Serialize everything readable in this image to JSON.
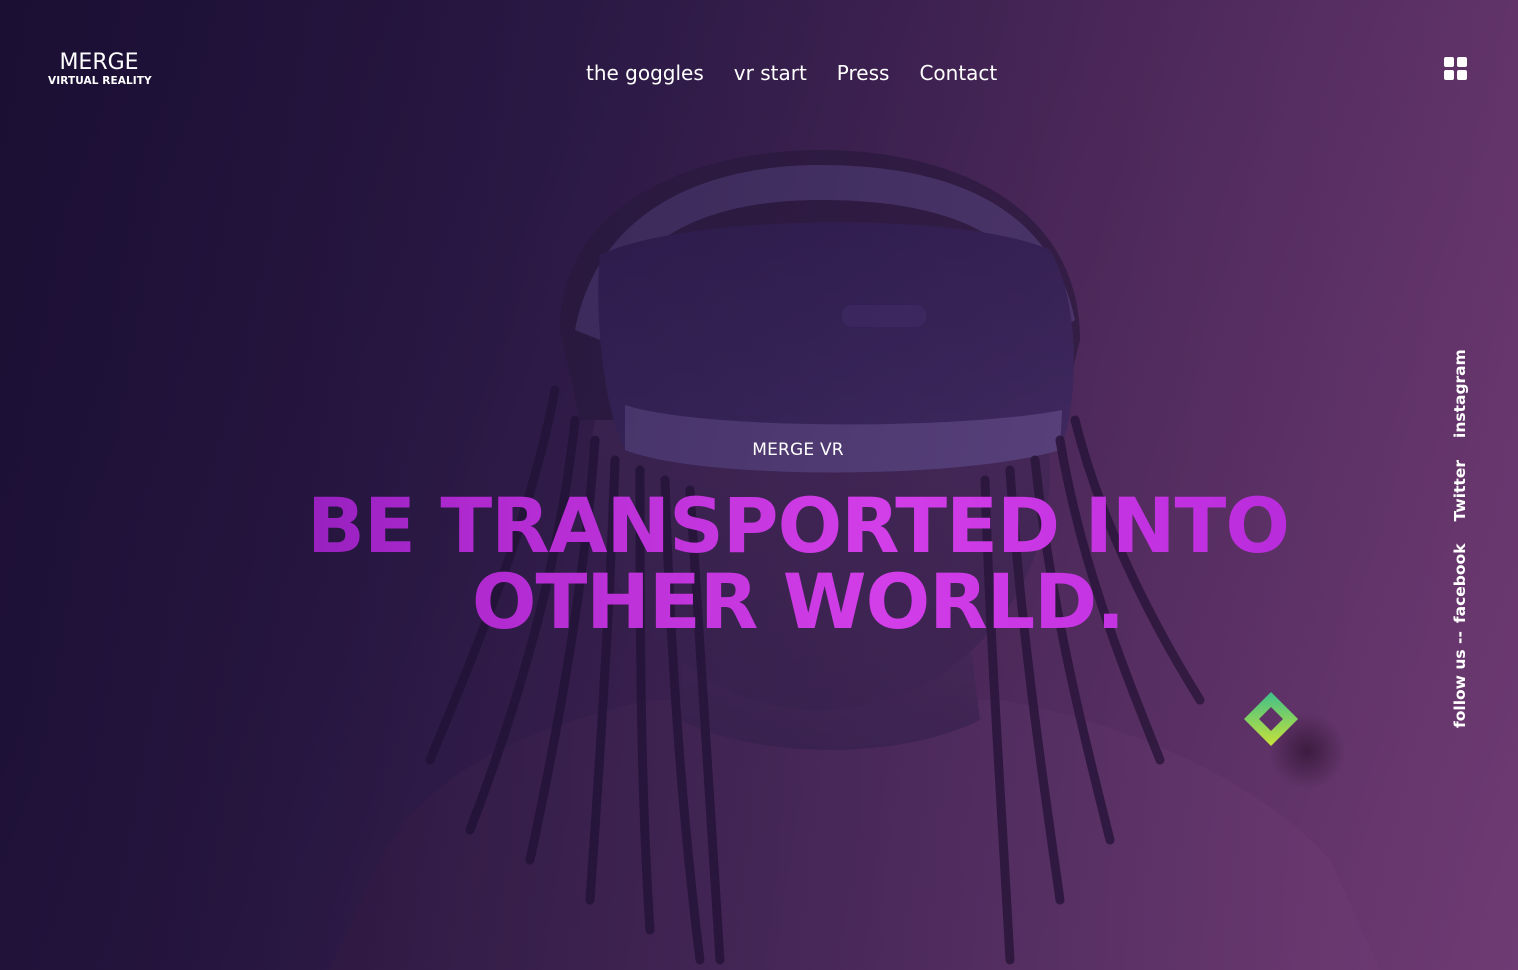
{
  "brand": {
    "name": "MERGE",
    "tagline": "VIRTUAL REALITY"
  },
  "nav": {
    "items": [
      {
        "label": "the goggles"
      },
      {
        "label": "vr start"
      },
      {
        "label": "Press"
      },
      {
        "label": "Contact"
      }
    ],
    "menu_icon": "grid-icon"
  },
  "hero": {
    "kicker": "MERGE VR",
    "headline_line1": "BE TRANSPORTED INTO",
    "headline_line2": "OTHER WORLD.",
    "background": "person-wearing-vr-headset"
  },
  "social": {
    "prefix": "follow us --",
    "links": [
      {
        "label": "facebook"
      },
      {
        "label": "Twitter"
      },
      {
        "label": "instagram"
      }
    ]
  },
  "decor": {
    "diamond_icon": "gradient-diamond-icon"
  },
  "colors": {
    "background": "#2b1a45",
    "headline_gradient_start": "#6a0fa0",
    "headline_gradient_mid": "#d23ee8",
    "diamond_top": "#3fbf8a",
    "diamond_bottom": "#c8e23a"
  }
}
